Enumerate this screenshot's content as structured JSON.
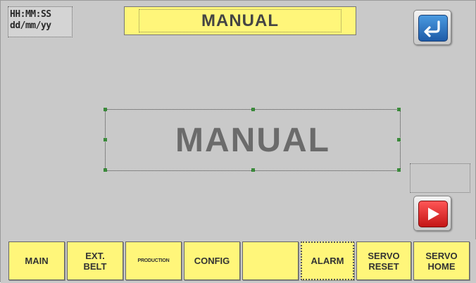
{
  "clock": {
    "time": "HH:MM:SS",
    "date": "dd/mm/yy"
  },
  "header": {
    "title": "MANUAL"
  },
  "main": {
    "title": "MANUAL"
  },
  "buttons": {
    "back_icon": "return-arrow-icon",
    "next_icon": "play-arrow-icon"
  },
  "colors": {
    "panel_bg": "#c9c9c9",
    "button_yellow": "#fff67a",
    "back_blue": "#2a6fc2",
    "next_red": "#e22020"
  },
  "nav": [
    {
      "label": "MAIN"
    },
    {
      "label": "EXT.\nBELT"
    },
    {
      "label": "PRODUCTION"
    },
    {
      "label": "CONFIG"
    },
    {
      "label": ""
    },
    {
      "label": "ALARM"
    },
    {
      "label": "SERVO\nRESET"
    },
    {
      "label": "SERVO\nHOME"
    }
  ]
}
